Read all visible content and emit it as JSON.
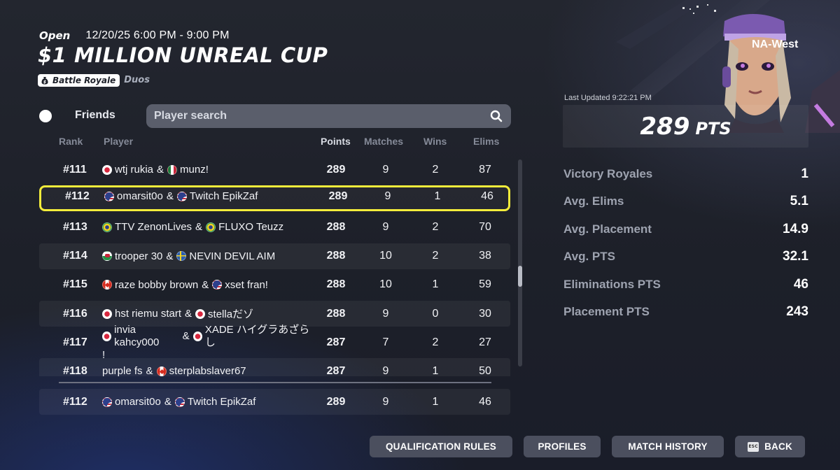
{
  "event": {
    "status": "Open",
    "datetime": "12/20/25 6:00 PM - 9:00 PM",
    "title": "$1 MILLION UNREAL CUP",
    "mode": "Battle Royale",
    "team_size": "Duos",
    "region": "NA-West"
  },
  "filters": {
    "friends_label": "Friends",
    "search_placeholder": "Player search"
  },
  "columns": [
    "Rank",
    "Player",
    "Points",
    "Matches",
    "Wins",
    "Elims"
  ],
  "rows": [
    {
      "rank": "#111",
      "p1": "wtj rukia",
      "f1": "jp",
      "p2": "munz!",
      "f2": "mx",
      "points": "289",
      "matches": "9",
      "wins": "2",
      "elims": "87"
    },
    {
      "rank": "#112",
      "p1": "omarsit0o",
      "f1": "us",
      "p2": "Twitch EpikZaf",
      "f2": "us",
      "points": "289",
      "matches": "9",
      "wins": "1",
      "elims": "46"
    },
    {
      "rank": "#113",
      "p1": "TTV ZenonLives",
      "f1": "br",
      "p2": "FLUXO Teuzz",
      "f2": "br",
      "points": "288",
      "matches": "9",
      "wins": "2",
      "elims": "70"
    },
    {
      "rank": "#114",
      "p1": "trooper 30",
      "f1": "wales",
      "p2": "NEVIN DEVIL AIM",
      "f2": "se",
      "points": "288",
      "matches": "10",
      "wins": "2",
      "elims": "38"
    },
    {
      "rank": "#115",
      "p1": "raze bobby brown",
      "f1": "ca",
      "p2": "xset fran!",
      "f2": "us",
      "points": "288",
      "matches": "10",
      "wins": "1",
      "elims": "59"
    },
    {
      "rank": "#116",
      "p1": "hst riemu start",
      "f1": "jp",
      "p2": "stellaだゾ",
      "f2": "jp",
      "points": "288",
      "matches": "9",
      "wins": "0",
      "elims": "30"
    },
    {
      "rank": "#117",
      "p1": "invia kahcy000",
      "f1": "jp",
      "p2": "XADE ハイグラあざらし",
      "p2_cont": "!",
      "f2": "jp",
      "points": "287",
      "matches": "7",
      "wins": "2",
      "elims": "27"
    },
    {
      "rank": "#118",
      "p1": "purple fs",
      "f1": "",
      "p2": "sterplabslaver67",
      "f2": "ca",
      "points": "287",
      "matches": "9",
      "wins": "1",
      "elims": "50"
    }
  ],
  "pinned_row": {
    "rank": "#112",
    "p1": "omarsit0o",
    "f1": "us",
    "p2": "Twitch EpikZaf",
    "f2": "us",
    "points": "289",
    "matches": "9",
    "wins": "1",
    "elims": "46"
  },
  "summary": {
    "last_updated": "Last Updated 9:22:21 PM",
    "points_value": "289",
    "points_unit": "PTS",
    "stats": [
      {
        "label": "Victory Royales",
        "value": "1"
      },
      {
        "label": "Avg. Elims",
        "value": "5.1"
      },
      {
        "label": "Avg. Placement",
        "value": "14.9"
      },
      {
        "label": "Avg. PTS",
        "value": "32.1"
      },
      {
        "label": "Eliminations PTS",
        "value": "46"
      },
      {
        "label": "Placement PTS",
        "value": "243"
      }
    ]
  },
  "buttons": {
    "qualification_rules": "QUALIFICATION RULES",
    "profiles": "PROFILES",
    "match_history": "MATCH HISTORY",
    "back": "BACK",
    "esc": "ESC"
  },
  "colors": {
    "highlight": "#f3ec3b",
    "button_bg": "#4b4f5e",
    "search_bg": "#5a5e6b"
  }
}
